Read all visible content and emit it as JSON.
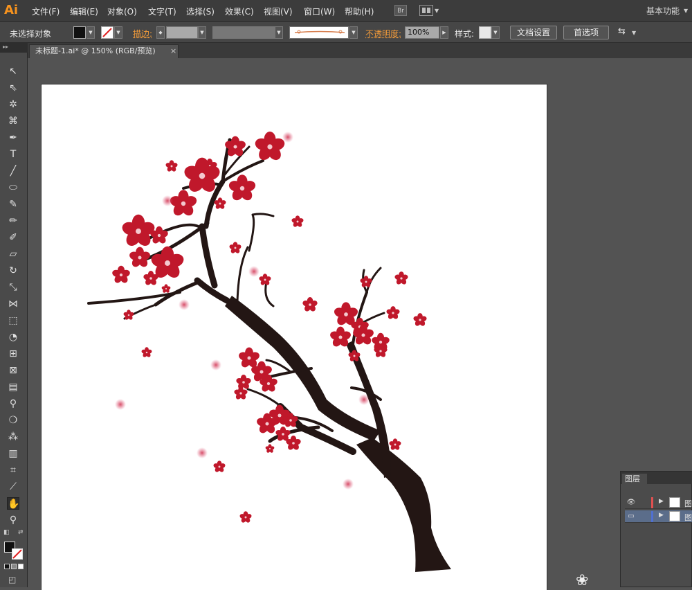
{
  "app": {
    "logo": "Ai"
  },
  "menu": {
    "items": [
      "文件(F)",
      "编辑(E)",
      "对象(O)",
      "文字(T)",
      "选择(S)",
      "效果(C)",
      "视图(V)",
      "窗口(W)",
      "帮助(H)"
    ],
    "bridge_label": "Br",
    "workspace": "基本功能"
  },
  "control": {
    "selection": "未选择对象",
    "stroke_label": "描边:",
    "opacity_label": "不透明度:",
    "opacity_value": "100%",
    "style_label": "样式:",
    "doc_setup": "文档设置",
    "prefs": "首选项"
  },
  "document": {
    "tab_title": "未标题-1.ai* @ 150% (RGB/预览)",
    "close": "×"
  },
  "layers": {
    "tab": "图层",
    "rows": [
      {
        "name": "图",
        "color": "#e05050"
      },
      {
        "name": "图",
        "color": "#5070d0"
      }
    ]
  },
  "colors": {
    "blossom": "#c0182b",
    "branch": "#231614"
  }
}
